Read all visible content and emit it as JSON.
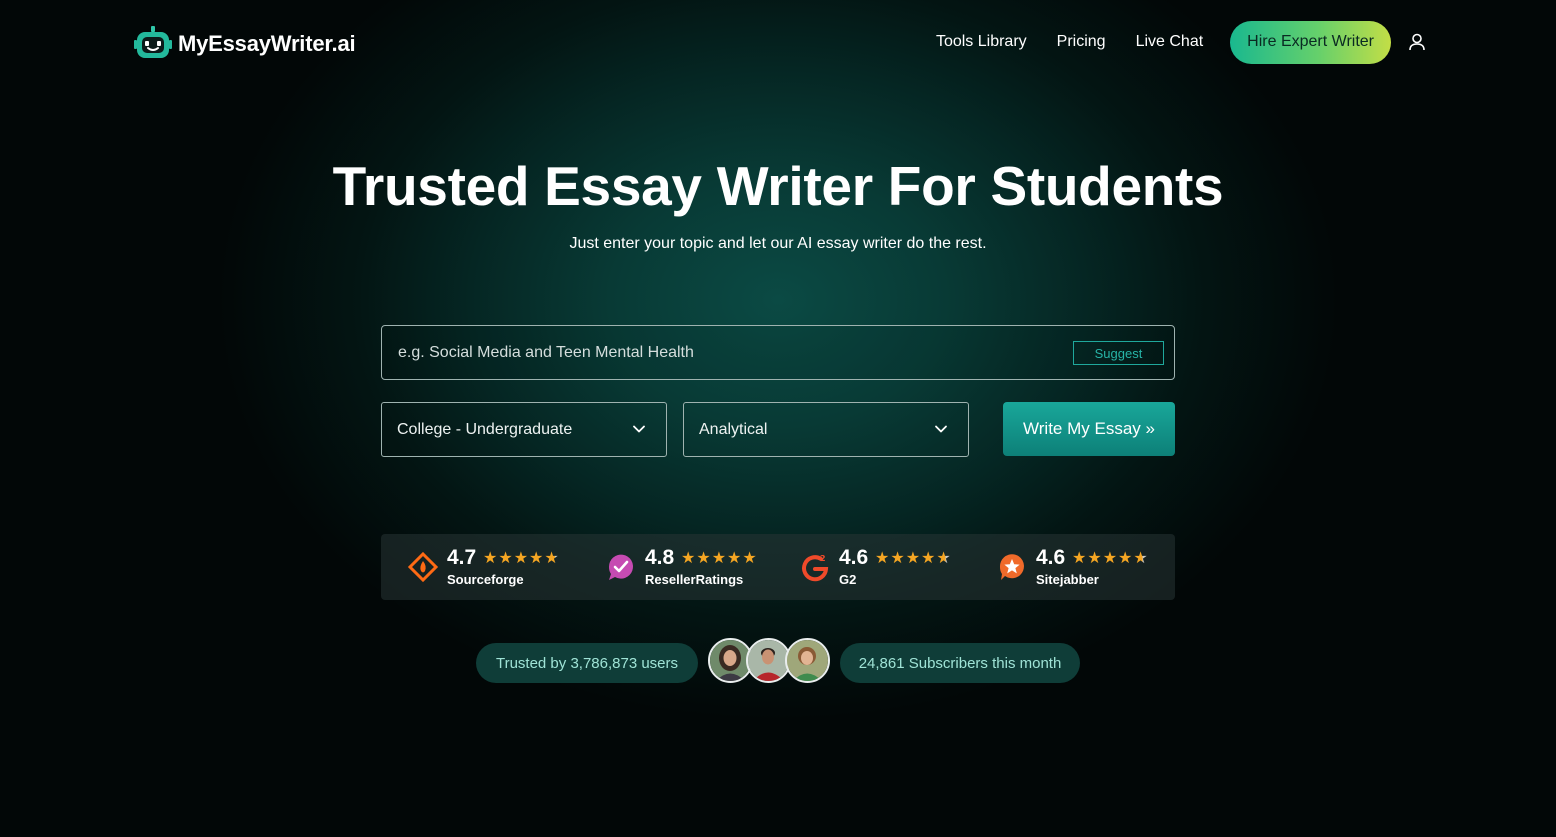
{
  "header": {
    "logo_text": "MyEssayWriter.ai",
    "nav": [
      "Tools Library",
      "Pricing",
      "Live Chat"
    ],
    "cta": "Hire Expert Writer",
    "user_icon": "user-icon"
  },
  "hero": {
    "title": "Trusted Essay Writer For Students",
    "subtitle": "Just enter your topic and let our AI essay writer do the rest."
  },
  "form": {
    "topic_placeholder": "e.g. Social Media and Teen Mental Health",
    "topic_value": "",
    "suggest_label": "Suggest",
    "level_selected": "College - Undergraduate",
    "type_selected": "Analytical",
    "submit_label": "Write My Essay »"
  },
  "ratings": [
    {
      "score": "4.7",
      "stars": 4.7,
      "name": "Sourceforge",
      "icon": "sourceforge-icon"
    },
    {
      "score": "4.8",
      "stars": 4.8,
      "name": "ResellerRatings",
      "icon": "resellerratings-icon"
    },
    {
      "score": "4.6",
      "stars": 4.6,
      "name": "G2",
      "icon": "g2-icon"
    },
    {
      "score": "4.6",
      "stars": 4.6,
      "name": "Sitejabber",
      "icon": "sitejabber-icon"
    }
  ],
  "trust": {
    "users": "Trusted by 3,786,873 users",
    "subscribers": "24,861 Subscribers this month"
  },
  "colors": {
    "accent_teal": "#0d8078",
    "cta_gradient_start": "#19b88f",
    "cta_gradient_end": "#c3de46",
    "star": "#f5a623",
    "pill_bg": "#0f3d38",
    "pill_text": "#9fe3d6"
  }
}
